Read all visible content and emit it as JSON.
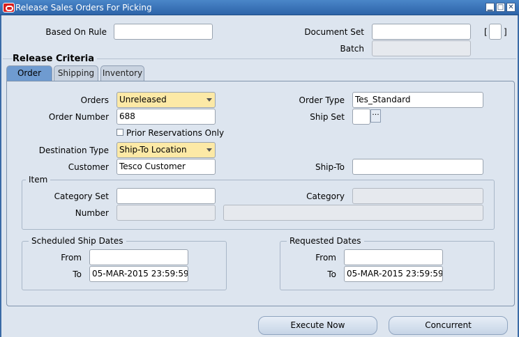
{
  "window": {
    "title": "Release Sales Orders For Picking",
    "controls": [
      "minimize-icon",
      "maximize-icon",
      "close-icon"
    ]
  },
  "header": {
    "based_on_rule_label": "Based On Rule",
    "based_on_rule_value": "",
    "document_set_label": "Document Set",
    "document_set_value": "",
    "batch_label": "Batch",
    "batch_value": "",
    "bracket_open": "[",
    "bracket_close": "]"
  },
  "release_criteria": {
    "title": "Release Criteria",
    "tabs": [
      {
        "label": "Order",
        "active": true
      },
      {
        "label": "Shipping",
        "active": false
      },
      {
        "label": "Inventory",
        "active": false
      }
    ]
  },
  "order_tab": {
    "orders_label": "Orders",
    "orders_value": "Unreleased",
    "order_number_label": "Order Number",
    "order_number_value": "688",
    "prior_reservations_label": "Prior Reservations Only",
    "prior_reservations_checked": false,
    "destination_type_label": "Destination Type",
    "destination_type_value": "Ship-To Location",
    "customer_label": "Customer",
    "customer_value": "Tesco Customer",
    "order_type_label": "Order Type",
    "order_type_value": "Tes_Standard",
    "ship_set_label": "Ship Set",
    "ship_set_value": "",
    "ship_to_label": "Ship-To",
    "ship_to_value": "",
    "item_group": {
      "title": "Item",
      "category_set_label": "Category Set",
      "category_set_value": "",
      "category_label": "Category",
      "category_value": "",
      "number_label": "Number",
      "number_value": "",
      "description_value": ""
    },
    "scheduled_ship_dates": {
      "title": "Scheduled Ship Dates",
      "from_label": "From",
      "from_value": "",
      "to_label": "To",
      "to_value": "05-MAR-2015 23:59:59"
    },
    "requested_dates": {
      "title": "Requested Dates",
      "from_label": "From",
      "from_value": "",
      "to_label": "To",
      "to_value": "05-MAR-2015 23:59:59"
    }
  },
  "footer": {
    "execute_now_label": "Execute Now",
    "concurrent_label": "Concurrent"
  },
  "colors": {
    "title_bar": "#2d64a8",
    "background": "#dde5ef",
    "required_field": "#fce9a6",
    "active_tab": "#6f9bd0"
  }
}
